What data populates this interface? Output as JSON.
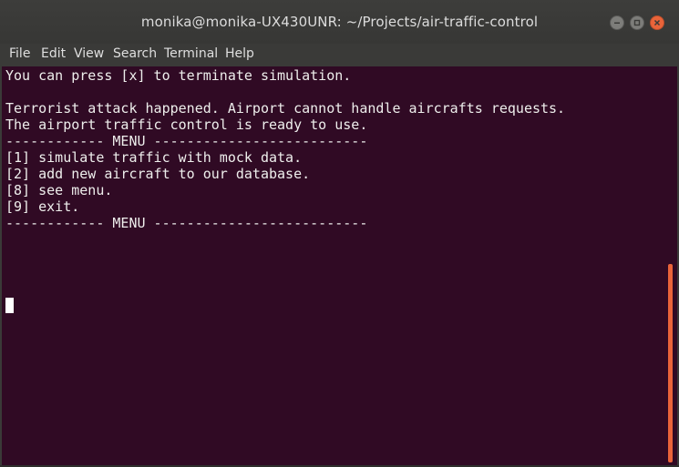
{
  "window": {
    "title": "monika@monika-UX430UNR: ~/Projects/air-traffic-control"
  },
  "menubar": {
    "items": [
      "File",
      "Edit",
      "View",
      "Search",
      "Terminal",
      "Help"
    ]
  },
  "terminal": {
    "lines": [
      "You can press [x] to terminate simulation.",
      "",
      "Terrorist attack happened. Airport cannot handle aircrafts requests.",
      "The airport traffic control is ready to use.",
      "------------ MENU --------------------------",
      "[1] simulate traffic with mock data.",
      "[2] add new aircraft to our database.",
      "[8] see menu.",
      "[9] exit.",
      "------------ MENU --------------------------"
    ],
    "background": "#300a24",
    "foreground": "#eeeeec"
  },
  "colors": {
    "accent": "#e9643a",
    "titlebar": "#3a3a38"
  },
  "icons": {
    "minimize": "minimize-icon",
    "maximize": "maximize-icon",
    "close": "close-icon"
  }
}
